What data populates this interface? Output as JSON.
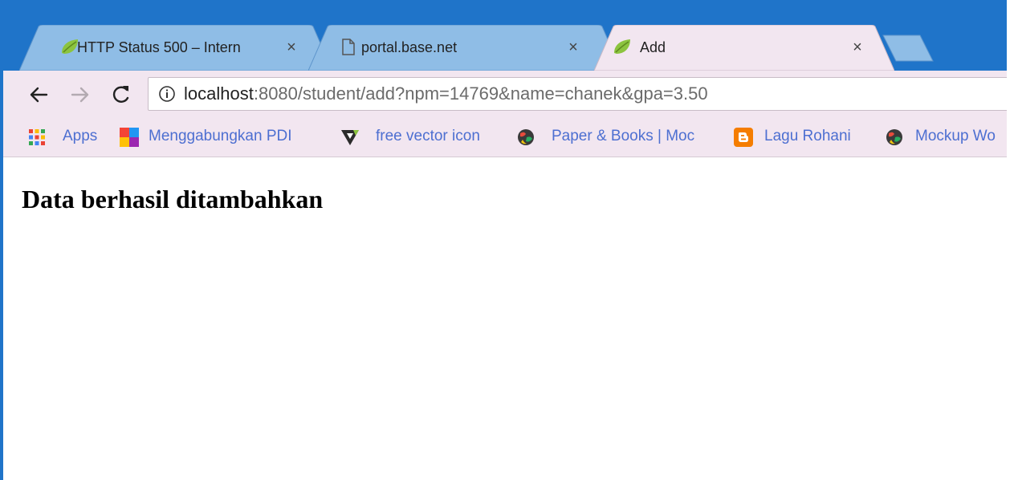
{
  "tabs": [
    {
      "title": "HTTP Status 500 – Intern",
      "icon": "spring-leaf-icon",
      "active": false
    },
    {
      "title": "portal.base.net",
      "icon": "page-icon",
      "active": false
    },
    {
      "title": "Add",
      "icon": "spring-leaf-icon",
      "active": true
    }
  ],
  "tab_close_glyph": "×",
  "omnibox": {
    "host": "localhost",
    "rest": ":8080/student/add?npm=14769&name=chanek&gpa=3.50"
  },
  "bookmarks": [
    {
      "label": "Apps",
      "icon": "apps-grid-icon"
    },
    {
      "label": "Menggabungkan PDI",
      "icon": "colorful-squares-icon"
    },
    {
      "label": "free vector icon",
      "icon": "vector-logo-icon"
    },
    {
      "label": "Paper & Books | Moc",
      "icon": "globe-icon"
    },
    {
      "label": "Lagu Rohani",
      "icon": "blogger-icon"
    },
    {
      "label": "Mockup Wo",
      "icon": "globe-icon"
    }
  ],
  "page": {
    "heading": "Data berhasil ditambahkan"
  },
  "colors": {
    "tabstrip": "#1f74c9",
    "inactive_tab": "#8fbde6",
    "active_tab": "#f2e6f0",
    "bookmark_text": "#4d6fd1",
    "blogger_orange": "#f57d00",
    "spring_green": "#8cc43f"
  }
}
